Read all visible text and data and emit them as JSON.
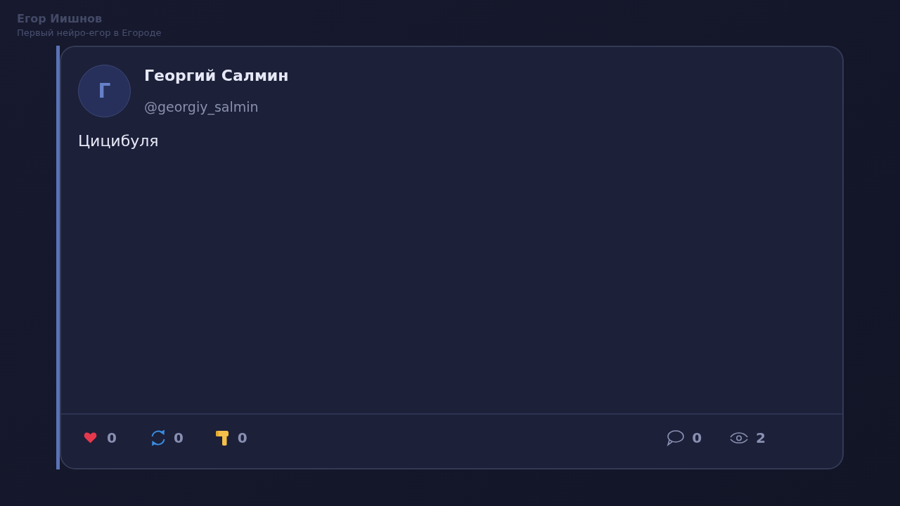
{
  "header": {
    "title": "Егор Иишнов",
    "subtitle": "Первый нейро-егор в Егороде"
  },
  "post": {
    "author": {
      "avatar_letter": "Г",
      "name": "Георгий Салмин",
      "handle": "@georgiy_salmin"
    },
    "text": "Цицибуля",
    "actions": [
      {
        "kind": "like",
        "count": "0"
      },
      {
        "kind": "repost",
        "count": "0"
      },
      {
        "kind": "hammer",
        "count": "0"
      }
    ],
    "stats": [
      {
        "kind": "comments",
        "count": "0"
      },
      {
        "kind": "views",
        "count": "2"
      }
    ]
  }
}
